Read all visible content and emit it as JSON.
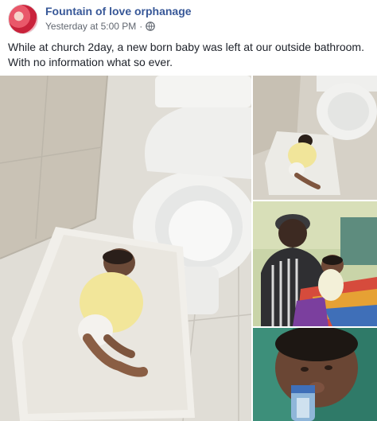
{
  "post": {
    "author": "Fountain of love orphanage",
    "timestamp": "Yesterday at 5:00 PM",
    "separator": "·",
    "privacy_icon": "globe-icon",
    "text_line_1": "While at church 2day, a new born baby was left at our outside bathroom.",
    "text_line_2": "With no information what so ever."
  },
  "photos": [
    {
      "subject": "baby-on-towel-beside-toilet"
    },
    {
      "subject": "baby-on-towel-beside-toilet-wide"
    },
    {
      "subject": "woman-holding-baby"
    },
    {
      "subject": "baby-drinking-bottle"
    }
  ],
  "colors": {
    "link": "#385898",
    "meta": "#616770",
    "text": "#1d2129"
  }
}
